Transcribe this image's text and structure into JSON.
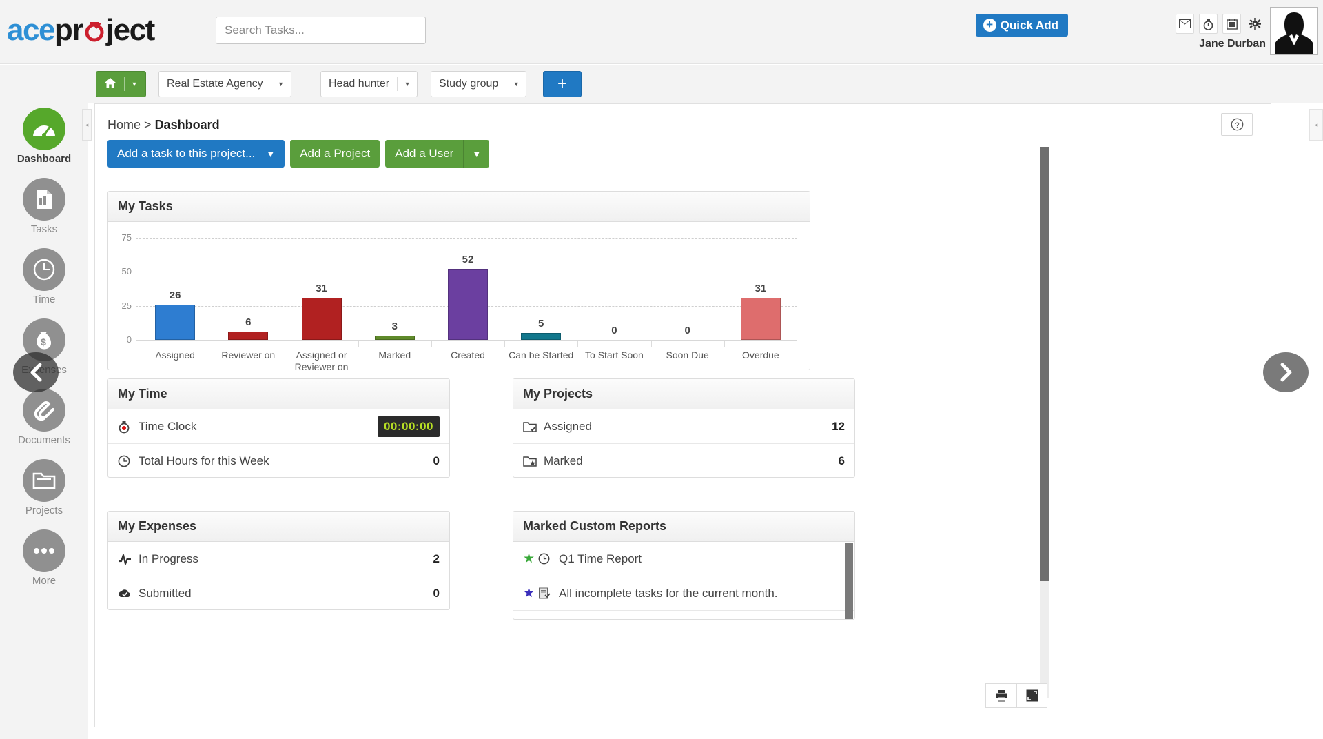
{
  "header": {
    "logo_text_1": "ace",
    "logo_text_2": "pr",
    "logo_text_3": "ject",
    "search_placeholder": "Search Tasks...",
    "search_value": "",
    "quick_add_label": "Quick Add",
    "plus_glyph": "+",
    "icons": [
      "mail-icon",
      "timer-icon",
      "calendar-icon",
      "gear-icon"
    ],
    "user_name": "Jane Durban"
  },
  "project_tabs": {
    "home_icon": "home-icon",
    "items": [
      {
        "label": "Real Estate Agency"
      },
      {
        "label": "Head hunter"
      },
      {
        "label": "Study group"
      }
    ],
    "add_label": "+",
    "caret": "▼"
  },
  "sidebar": {
    "items": [
      {
        "label": "Dashboard",
        "icon": "dashboard-icon",
        "active": true
      },
      {
        "label": "Tasks",
        "icon": "tasks-icon",
        "active": false
      },
      {
        "label": "Time",
        "icon": "time-icon",
        "active": false
      },
      {
        "label": "Expenses",
        "icon": "expenses-icon",
        "active": false
      },
      {
        "label": "Documents",
        "icon": "documents-icon",
        "active": false
      },
      {
        "label": "Projects",
        "icon": "projects-icon",
        "active": false
      },
      {
        "label": "More",
        "icon": "more-icon",
        "active": false
      }
    ]
  },
  "breadcrumb": {
    "home": "Home",
    "separator": ">",
    "current": "Dashboard"
  },
  "actions": {
    "add_task_label": "Add a task to this project...",
    "add_task_caret": "▼",
    "add_project_label": "Add a Project",
    "add_user_label": "Add a User",
    "add_user_caret": "▼"
  },
  "help_button": {
    "glyph": "?"
  },
  "chart_data": {
    "type": "bar",
    "title": "My Tasks",
    "xlabel": "",
    "ylabel": "",
    "ylim": [
      0,
      75
    ],
    "yticks": [
      0,
      25,
      50,
      75
    ],
    "grid": true,
    "legend": "none",
    "categories": [
      "Assigned",
      "Reviewer on",
      "Assigned or Reviewer on",
      "Marked",
      "Created",
      "Can be Started",
      "To Start Soon",
      "Soon Due",
      "Overdue"
    ],
    "values": [
      26,
      6,
      31,
      3,
      52,
      5,
      0,
      0,
      31
    ],
    "colors": [
      "#2e7dd1",
      "#b12121",
      "#b12121",
      "#5f8a2a",
      "#6b3fa0",
      "#11778c",
      "#cccccc",
      "#cccccc",
      "#de6d6d"
    ]
  },
  "panels": {
    "my_time": {
      "title": "My Time",
      "rows": [
        {
          "icon": "stopwatch-icon",
          "label": "Time Clock",
          "value": "00:00:00",
          "is_clock": true
        },
        {
          "icon": "clock-icon",
          "label": "Total Hours for this Week",
          "value": "0",
          "is_clock": false
        }
      ]
    },
    "my_projects": {
      "title": "My Projects",
      "rows": [
        {
          "icon": "folder-check-icon",
          "label": "Assigned",
          "value": "12"
        },
        {
          "icon": "folder-star-icon",
          "label": "Marked",
          "value": "6"
        }
      ]
    },
    "my_expenses": {
      "title": "My Expenses",
      "rows": [
        {
          "icon": "pulse-icon",
          "label": "In Progress",
          "value": "2"
        },
        {
          "icon": "cloud-check-icon",
          "label": "Submitted",
          "value": "0"
        }
      ]
    },
    "marked_custom_reports": {
      "title": "Marked Custom Reports",
      "rows": [
        {
          "star": "★",
          "star_color": "#3aa93a",
          "icon": "clock-icon",
          "label": "Q1 Time Report"
        },
        {
          "star": "★",
          "star_color": "#3b2fbb",
          "icon": "report-icon",
          "label": "All incomplete tasks for the current month."
        }
      ]
    }
  },
  "footer_tools": [
    {
      "icon": "print-icon"
    },
    {
      "icon": "fullscreen-icon"
    }
  ],
  "overlays": {
    "left_arrow": "❮",
    "right_arrow": "❯",
    "collapse_left": "◂",
    "collapse_right": "◂"
  },
  "colors": {
    "brand_blue": "#2079c3",
    "brand_green": "#5a9e3c",
    "accent_green": "#56a82b",
    "logo_blue": "#2d8fd5",
    "logo_red": "#cc1f2d"
  }
}
